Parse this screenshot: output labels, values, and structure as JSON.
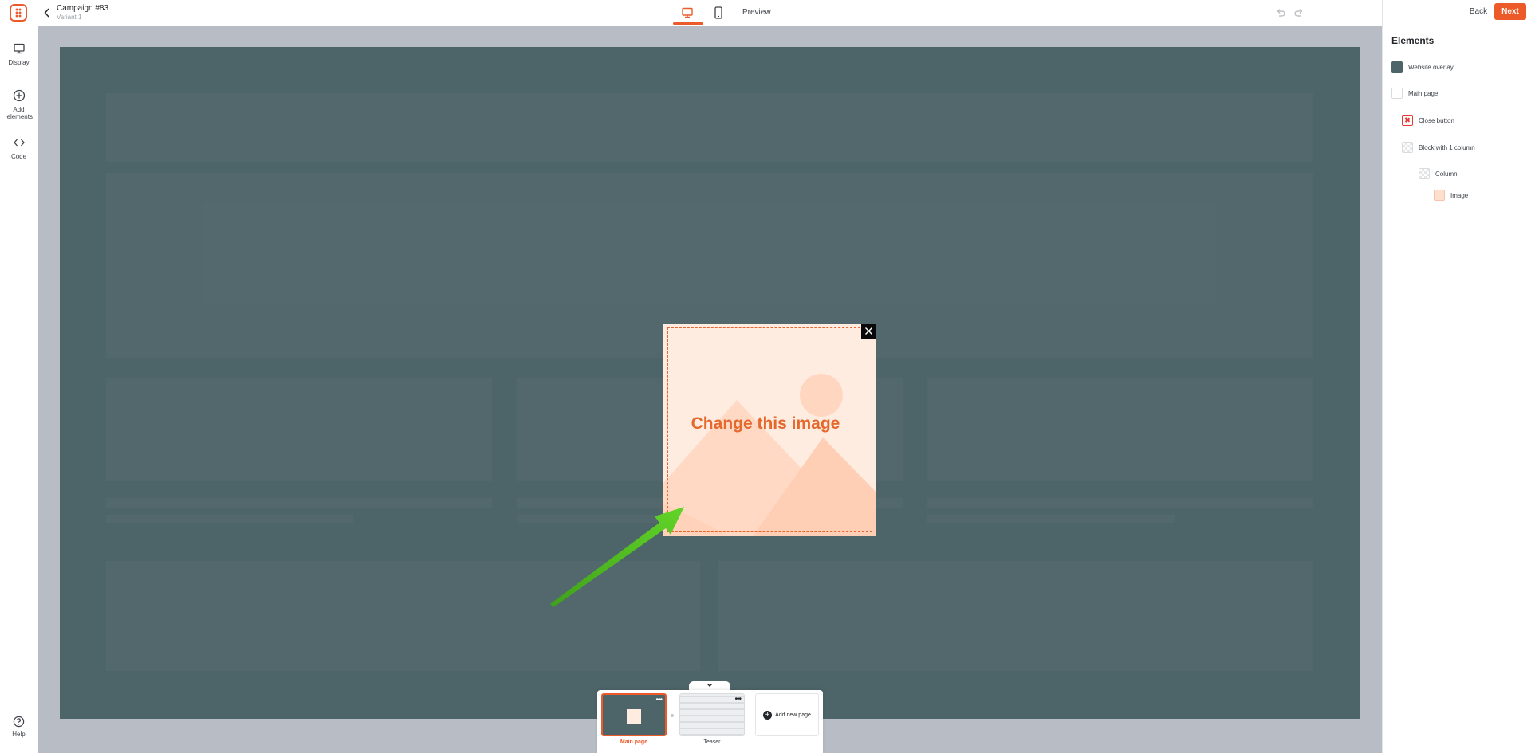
{
  "app": {
    "campaign_title": "Campaign #83",
    "variant_label": "Variant 1"
  },
  "left_sidebar": {
    "display_label": "Display",
    "add_elements_label": "Add elements",
    "code_label": "Code",
    "help_label": "Help"
  },
  "top_bar": {
    "preview_label": "Preview",
    "active_device": "desktop"
  },
  "right_panel": {
    "back_label": "Back",
    "next_label": "Next",
    "elements_heading": "Elements",
    "tree": [
      {
        "label": "Website overlay",
        "icon": "color-swatch-dark"
      },
      {
        "label": "Main page",
        "icon": "color-swatch-white"
      },
      {
        "label": "Close button",
        "icon": "close-circle-icon"
      },
      {
        "label": "Block with 1 column",
        "icon": "checker-icon"
      },
      {
        "label": "Column",
        "icon": "checker-icon"
      },
      {
        "label": "Image",
        "icon": "image-icon"
      }
    ]
  },
  "canvas": {
    "popup_text": "Change this image",
    "overlay_color": "#4d6469",
    "popup_bg": "#ffece1",
    "accent": "#ed5a29"
  },
  "pages": {
    "items": [
      {
        "label": "Main page",
        "active": true
      },
      {
        "label": "Teaser",
        "active": false
      }
    ],
    "add_label": "Add new page"
  }
}
